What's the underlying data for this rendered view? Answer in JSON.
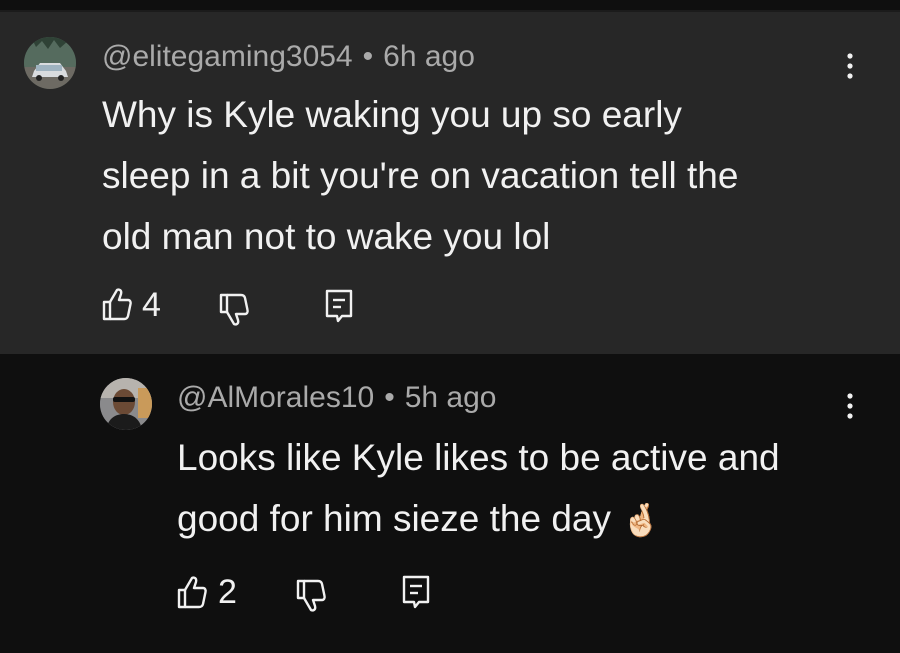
{
  "comment": {
    "author": "@elitegaming3054",
    "time": "6h ago",
    "separator": "•",
    "text_lines": [
      "Why is Kyle waking you up so early",
      "sleep in a bit you're on vacation tell the",
      "old man not to wake you lol"
    ],
    "likes": "4",
    "icons": [
      "car-avatar",
      "kebab-menu-icon",
      "thumbs-up-icon",
      "thumbs-down-icon",
      "reply-comment-icon"
    ]
  },
  "reply": {
    "author": "@AlMorales10",
    "time": "5h ago",
    "separator": "•",
    "text_lines": [
      "Looks like Kyle likes to be active and",
      "good for him sieze the day"
    ],
    "emoji": "🤞🏻",
    "likes": "2",
    "icons": [
      "person-avatar",
      "kebab-menu-icon",
      "thumbs-up-icon",
      "thumbs-down-icon",
      "reply-comment-icon"
    ]
  },
  "colors": {
    "comment_bg": "#272727",
    "reply_bg": "#0f0f0f",
    "text": "#f1f1f1",
    "meta": "#aaaaaa"
  }
}
